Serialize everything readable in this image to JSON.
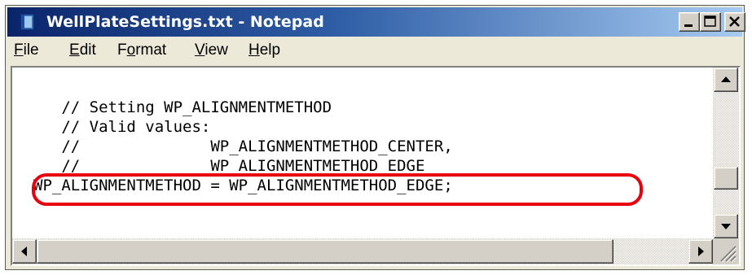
{
  "window": {
    "title": "WellPlateSettings.txt - Notepad"
  },
  "menu": {
    "file": {
      "hotkey": "F",
      "rest": "ile"
    },
    "edit": {
      "hotkey": "E",
      "rest": "dit"
    },
    "format": {
      "pre": "F",
      "hotkey": "o",
      "rest": "rmat"
    },
    "view": {
      "hotkey": "V",
      "rest": "iew"
    },
    "help": {
      "hotkey": "H",
      "rest": "elp"
    }
  },
  "editor": {
    "lines": [
      "   // Setting WP_ALIGNMENTMETHOD",
      "   // Valid values:",
      "   //              WP_ALIGNMENTMETHOD_CENTER,",
      "   //              WP_ALIGNMENTMETHOD_EDGE",
      "WP_ALIGNMENTMETHOD = WP_ALIGNMENTMETHOD_EDGE;"
    ]
  },
  "annotation": {
    "highlight_color": "#e8000c"
  },
  "icons": {
    "app": "notepad-icon",
    "minimize": "minimize-icon",
    "maximize": "maximize-icon",
    "close": "close-icon",
    "scroll_up": "arrow-up-icon",
    "scroll_down": "arrow-down-icon",
    "scroll_left": "arrow-left-icon",
    "scroll_right": "arrow-right-icon",
    "grip": "resize-grip-icon"
  }
}
